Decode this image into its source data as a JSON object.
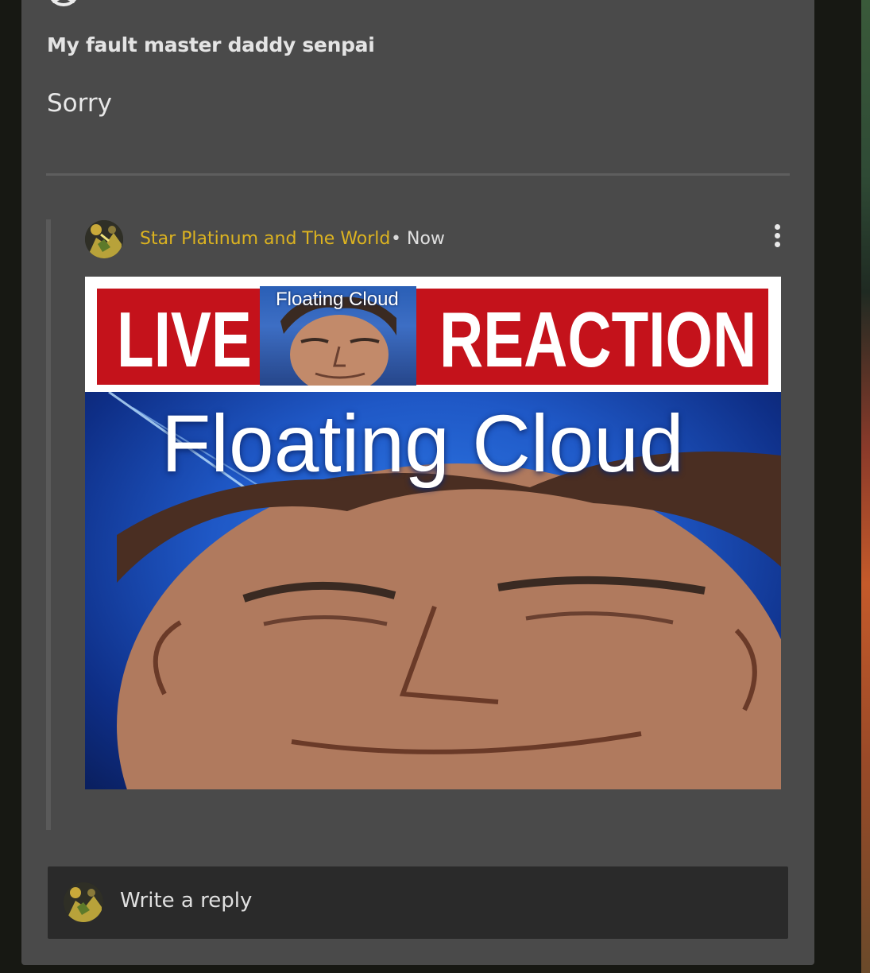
{
  "post": {
    "title": "My fault master daddy senpai",
    "body": "Sorry"
  },
  "comment": {
    "author": "Star Platinum and The World",
    "separator": "•",
    "time": "Now",
    "menu_icon": "more-vertical-icon",
    "image": {
      "banner_left": "LIVE",
      "banner_right": "REACTION",
      "thumbnail_label": "Floating Cloud",
      "main_caption": "Floating Cloud",
      "colors": {
        "banner_red": "#c4121b",
        "background_blue": "#1f58c6"
      }
    }
  },
  "reply": {
    "placeholder": "Write a reply"
  },
  "colors": {
    "page_bg": "#171813",
    "card_bg": "#4a4a4a",
    "author_accent": "#dcb320",
    "reply_box_bg": "#2a2a2a"
  }
}
